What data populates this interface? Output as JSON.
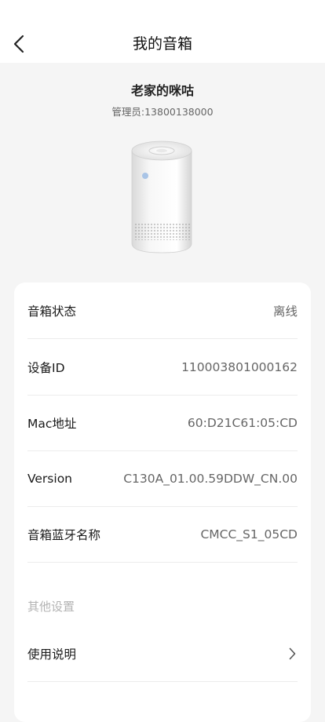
{
  "header": {
    "title": "我的音箱",
    "back_icon": "chevron-left-icon"
  },
  "device": {
    "name": "老家的咪咕",
    "admin": "管理员:13800138000"
  },
  "info": {
    "rows": [
      {
        "label": "音箱状态",
        "value": "离线"
      },
      {
        "label": "设备ID",
        "value": "110003801000162"
      },
      {
        "label": "Mac地址",
        "value": "60:D21C61:05:CD"
      },
      {
        "label": "Version",
        "value": "C130A_01.00.59DDW_CN.00"
      },
      {
        "label": "音箱蓝牙名称",
        "value": "CMCC_S1_05CD"
      }
    ]
  },
  "other": {
    "section_title": "其他设置",
    "items": [
      {
        "label": "使用说明",
        "icon": "chevron-right-icon"
      }
    ]
  },
  "colors": {
    "background": "#f5f5f5",
    "card": "#ffffff",
    "divider": "#ececec",
    "muted": "#b3b3b3"
  }
}
